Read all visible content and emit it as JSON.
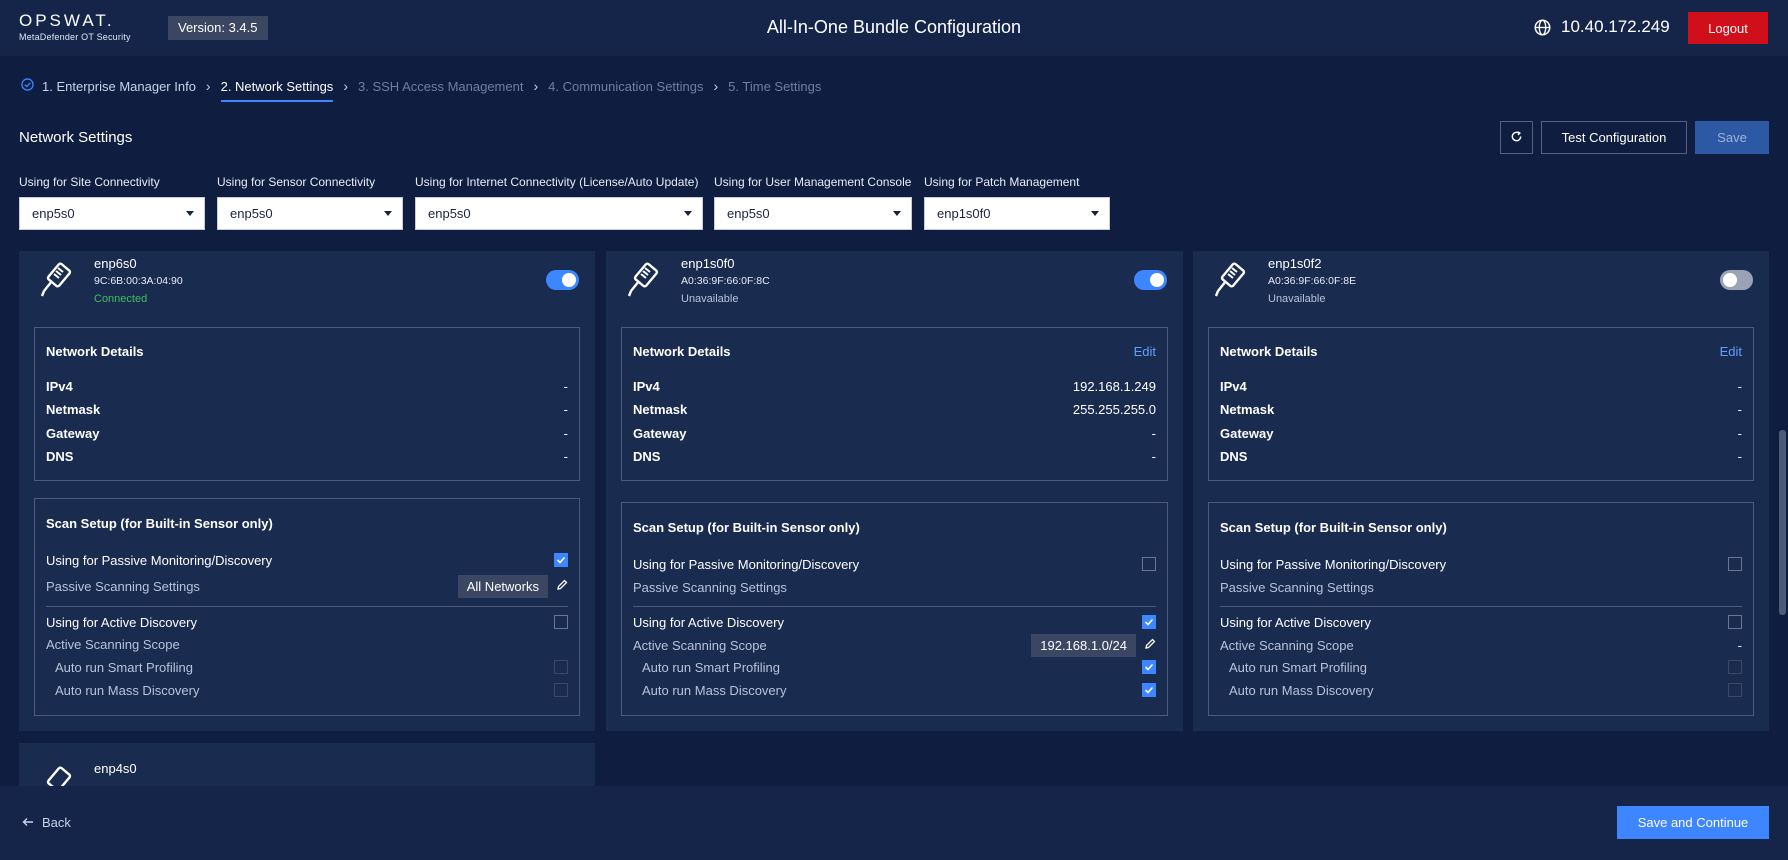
{
  "header": {
    "logo_main": "OPSWAT.",
    "logo_sub": "MetaDefender OT Security",
    "version": "Version: 3.4.5",
    "title": "All-In-One Bundle Configuration",
    "ip": "10.40.172.249",
    "logout_label": "Logout"
  },
  "stepper": [
    {
      "label": "1. Enterprise Manager Info",
      "state": "done"
    },
    {
      "label": "2. Network Settings",
      "state": "active"
    },
    {
      "label": "3. SSH Access Management",
      "state": "pending"
    },
    {
      "label": "4. Communication Settings",
      "state": "pending"
    },
    {
      "label": "5. Time Settings",
      "state": "pending"
    }
  ],
  "section": {
    "title": "Network Settings",
    "test_label": "Test Configuration",
    "save_label": "Save"
  },
  "dropdowns": [
    {
      "label": "Using for Site Connectivity",
      "value": "enp5s0"
    },
    {
      "label": "Using for Sensor Connectivity",
      "value": "enp5s0"
    },
    {
      "label": "Using for Internet Connectivity (License/Auto Update)",
      "value": "enp5s0"
    },
    {
      "label": "Using for User Management Console",
      "value": "enp5s0"
    },
    {
      "label": "Using for Patch Management",
      "value": "enp1s0f0"
    }
  ],
  "labels": {
    "network_details": "Network Details",
    "edit": "Edit",
    "ipv4": "IPv4",
    "netmask": "Netmask",
    "gateway": "Gateway",
    "dns": "DNS",
    "scan_setup": "Scan Setup (for Built-in Sensor only)",
    "passive_monitoring": "Using for Passive Monitoring/Discovery",
    "passive_settings": "Passive Scanning Settings",
    "active_discovery": "Using for Active Discovery",
    "active_scope": "Active Scanning Scope",
    "smart_profiling": "Auto run Smart Profiling",
    "mass_discovery": "Auto run Mass Discovery"
  },
  "cards": [
    {
      "name": "enp6s0",
      "mac": "9C:6B:00:3A:04:90",
      "status": "Connected",
      "enabled": true,
      "ipv4": "-",
      "netmask": "-",
      "gateway": "-",
      "dns": "-",
      "passive": true,
      "passive_chip": "All Networks",
      "active": false,
      "active_scope": "",
      "smart": false,
      "mass": false
    },
    {
      "name": "enp1s0f0",
      "mac": "A0:36:9F:66:0F:8C",
      "status": "Unavailable",
      "enabled": true,
      "ipv4": "192.168.1.249",
      "netmask": "255.255.255.0",
      "gateway": "-",
      "dns": "-",
      "passive": false,
      "passive_chip": "",
      "active": true,
      "active_scope": "192.168.1.0/24",
      "smart": true,
      "mass": true
    },
    {
      "name": "enp1s0f2",
      "mac": "A0:36:9F:66:0F:8E",
      "status": "Unavailable",
      "enabled": false,
      "ipv4": "-",
      "netmask": "-",
      "gateway": "-",
      "dns": "-",
      "passive": false,
      "passive_chip": "",
      "active": false,
      "active_scope": "-",
      "smart": false,
      "mass": false
    },
    {
      "name": "enp4s0"
    }
  ],
  "footer": {
    "back_label": "Back",
    "continue_label": "Save and Continue"
  },
  "colors": {
    "background": "#0f1d40",
    "card": "#1a2b50",
    "accent": "#3d86ff",
    "logout": "#d10f1b",
    "connected": "#3fbe5d"
  }
}
